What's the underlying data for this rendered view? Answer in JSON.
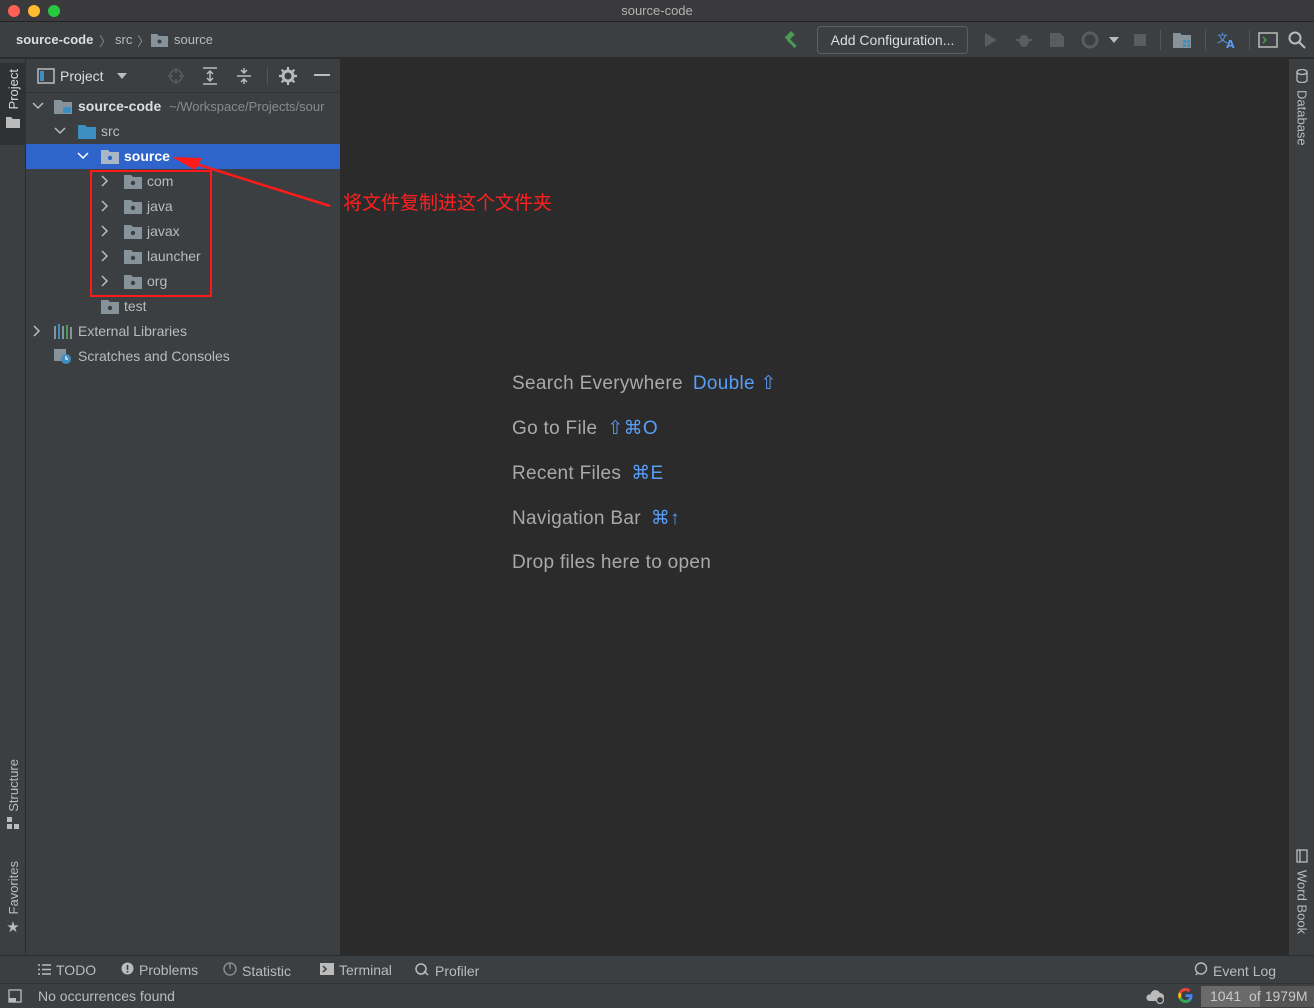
{
  "window": {
    "title": "source-code"
  },
  "navbar": {
    "breadcrumbs": [
      "source-code",
      "src",
      "source"
    ],
    "run_config_label": "Add Configuration..."
  },
  "left_stripe": {
    "project_tab": "Project",
    "structure_tab": "Structure",
    "favorites_tab": "Favorites"
  },
  "right_stripe": {
    "database_tab": "Database",
    "wordbook_tab": "Word Book"
  },
  "project_panel": {
    "view_label": "Project",
    "root": {
      "name": "source-code",
      "path": "~/Workspace/Projects/sour"
    },
    "src": "src",
    "source": "source",
    "children": [
      "com",
      "java",
      "javax",
      "launcher",
      "org"
    ],
    "test": "test",
    "external_libraries": "External Libraries",
    "scratches": "Scratches and Consoles"
  },
  "editor": {
    "hints": [
      {
        "label": "Search Everywhere",
        "shortcut": "Double ⇧"
      },
      {
        "label": "Go to File",
        "shortcut": "⇧⌘O"
      },
      {
        "label": "Recent Files",
        "shortcut": "⌘E"
      },
      {
        "label": "Navigation Bar",
        "shortcut": "⌘↑"
      },
      {
        "label": "Drop files here to open",
        "shortcut": ""
      }
    ]
  },
  "annotation": {
    "text": "将文件复制进这个文件夹",
    "color": "#ff1a1a"
  },
  "tool_windows": {
    "todo": "TODO",
    "problems": "Problems",
    "statistic": "Statistic",
    "terminal": "Terminal",
    "profiler": "Profiler",
    "event_log": "Event Log"
  },
  "status": {
    "message": "No occurrences found",
    "memory_used": "1041",
    "memory_of": "of",
    "memory_total": "1979M",
    "memory_fraction": 0.526
  },
  "colors": {
    "selection": "#2f65ca",
    "shortcut": "#589df6",
    "folder": "#87939a",
    "source_folder": "#3d8fc2"
  }
}
